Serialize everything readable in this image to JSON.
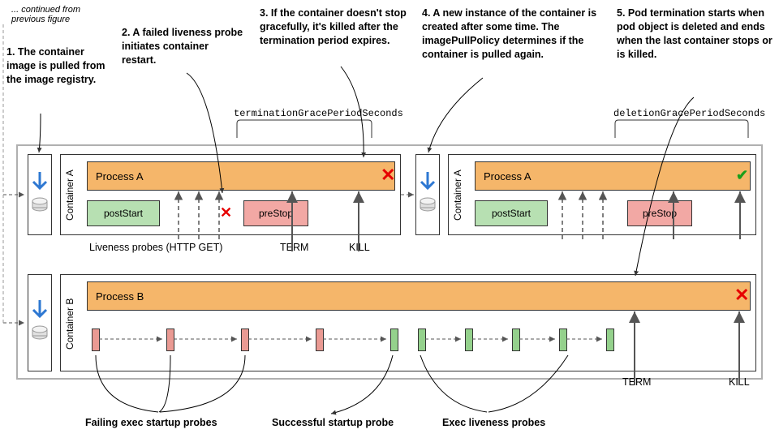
{
  "continued": "... continued from previous figure",
  "callouts": {
    "c1": "1. The container image is pulled from the image registry.",
    "c2": "2. A failed liveness probe initiates container restart.",
    "c3": "3. If the container doesn't stop gracefully, it's killed after the termination period expires.",
    "c4": "4. A new instance of the container is created after some time. The imagePullPolicy determines if the container is pulled again.",
    "c5": "5. Pod termination starts when pod object is deleted and ends when the last container stops or is killed."
  },
  "bracketLabels": {
    "termination": "terminationGracePeriodSeconds",
    "deletion": "deletionGracePeriodSeconds"
  },
  "containerA": "Container A",
  "containerB": "Container B",
  "processA": "Process A",
  "processB": "Process B",
  "postStart": "postStart",
  "preStop": "preStop",
  "rowLabels": {
    "liveness": "Liveness probes (HTTP GET)",
    "term": "TERM",
    "kill": "KILL"
  },
  "bottomLabels": {
    "failing": "Failing exec startup probes",
    "successful": "Successful startup probe",
    "exec": "Exec liveness probes"
  }
}
